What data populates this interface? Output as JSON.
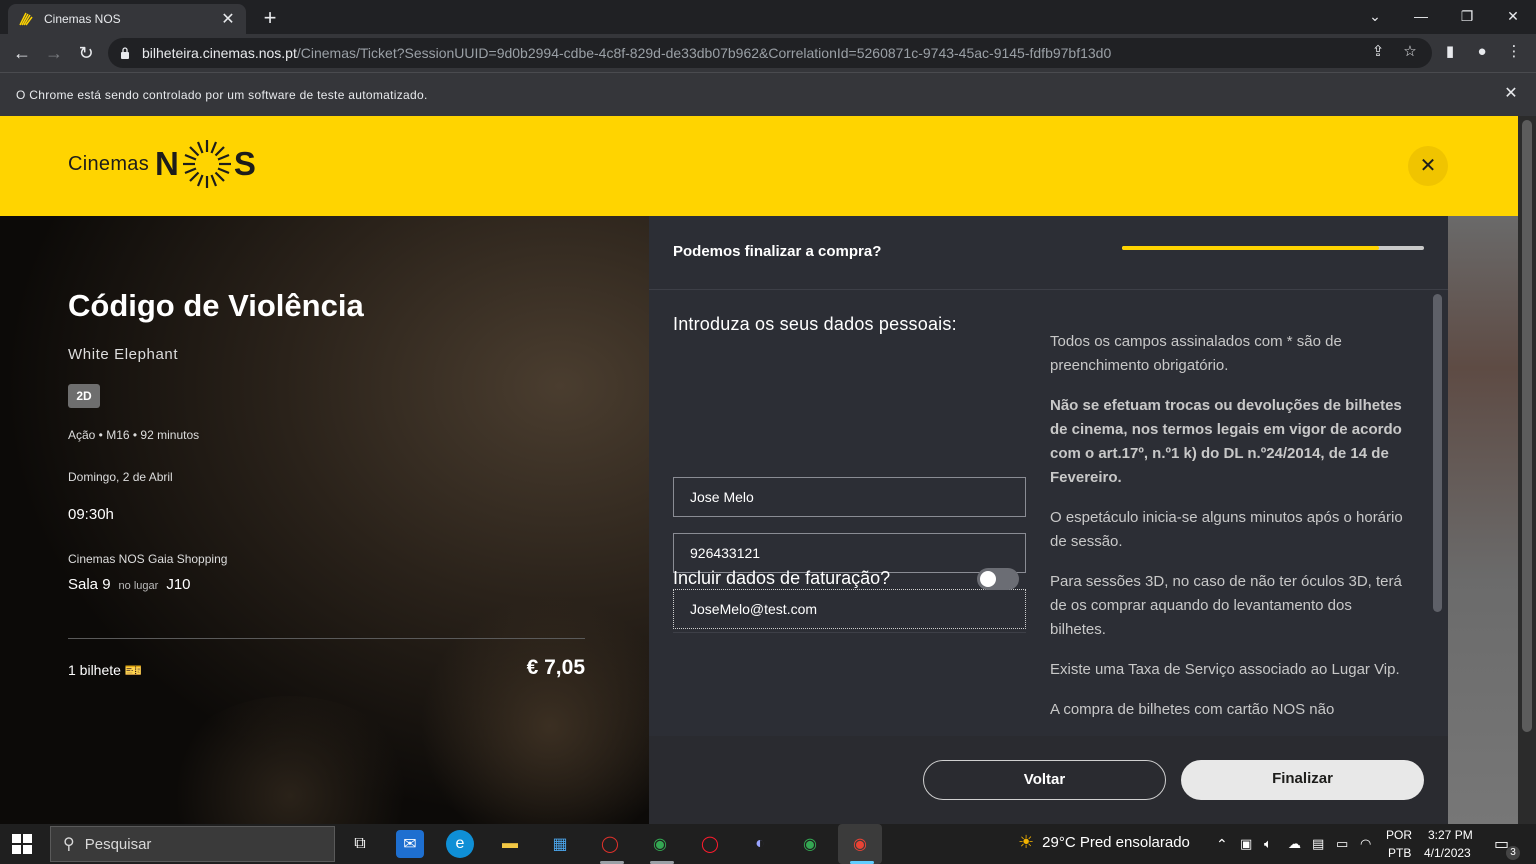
{
  "browser": {
    "tab_title": "Cinemas NOS",
    "url_host": "bilheteira.cinemas.nos.pt",
    "url_path": "/Cinemas/Ticket?SessionUUID=9d0b2994-cdbe-4c8f-829d-de33db07b962&CorrelationId=5260871c-9743-45ac-9145-fdfb97bf13d0",
    "infobar_text": "O Chrome está sendo controlado por um software de teste automatizado."
  },
  "header": {
    "logo_cinemas": "Cinemas",
    "logo_nos_left": "N",
    "logo_nos_right": "S",
    "close_label": "✕",
    "brand_color": "#ffd400"
  },
  "movie": {
    "title": "Código de Violência",
    "original_title": "White Elephant",
    "format": "2D",
    "details": "Ação • M16 • 92 minutos",
    "date": "Domingo, 2 de Abril",
    "time": "09:30h",
    "cinema": "Cinemas NOS Gaia Shopping",
    "room": "Sala 9",
    "seat_label": "no lugar",
    "seat": "J10",
    "tickets": "1 bilhete",
    "price": "€ 7,05"
  },
  "checkout": {
    "question": "Podemos finalizar a compra?",
    "progress_fraction": 0.85,
    "form_title": "Introduza os seus dados pessoais:",
    "name_value": "Jose Melo",
    "phone_value": "926433121",
    "email_value": "JoseMelo@test.com",
    "billing_toggle_label": "Incluir dados de faturação?",
    "billing_toggle_on": false,
    "notes": [
      "Todos os campos assinalados com * são de preenchimento obrigatório.",
      "Não se efetuam trocas ou devoluções de bilhetes de cinema, nos termos legais em vigor de acordo com o art.17º, n.º1 k) do DL n.º24/2014, de 14 de Fevereiro.",
      "O espetáculo inicia-se alguns minutos após o horário de sessão.",
      "Para sessões 3D, no caso de não ter óculos 3D, terá de os comprar aquando do levantamento dos bilhetes.",
      "Existe uma Taxa de Serviço associado ao Lugar Vip.",
      "A compra de bilhetes com cartão NOS não"
    ],
    "back_label": "Voltar",
    "finish_label": "Finalizar"
  },
  "taskbar": {
    "search_placeholder": "Pesquisar",
    "weather": "29°C  Pred ensolarado",
    "lang_top": "POR",
    "lang_bottom": "PTB",
    "time": "3:27 PM",
    "date": "4/1/2023",
    "notif_count": "3"
  }
}
